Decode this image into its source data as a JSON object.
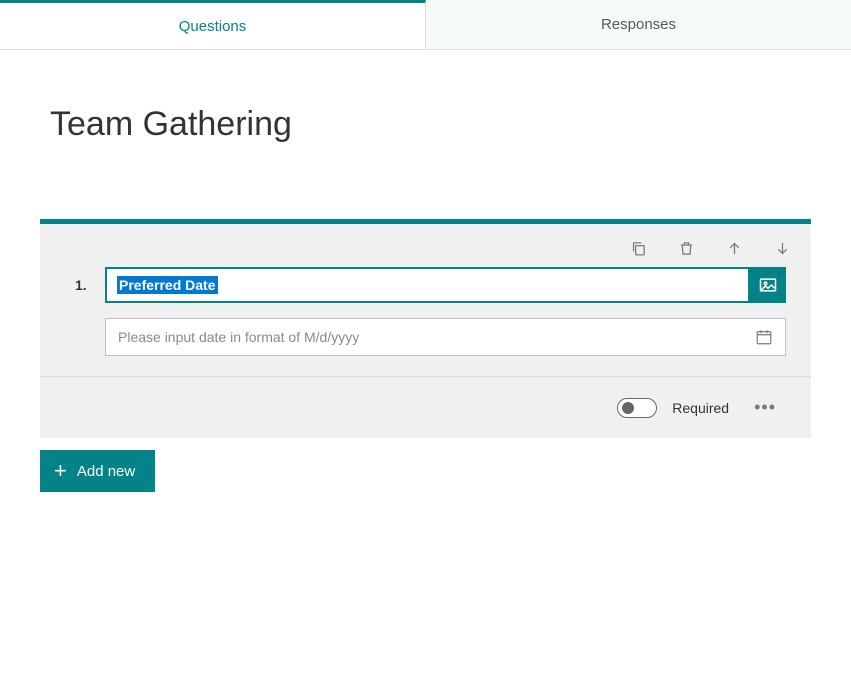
{
  "tabs": {
    "questions": "Questions",
    "responses": "Responses"
  },
  "form": {
    "title": "Team Gathering"
  },
  "question": {
    "number": "1.",
    "title": "Preferred Date",
    "date_placeholder": "Please input date in format of M/d/yyyy"
  },
  "footer": {
    "required_label": "Required",
    "add_new_label": "Add new"
  }
}
